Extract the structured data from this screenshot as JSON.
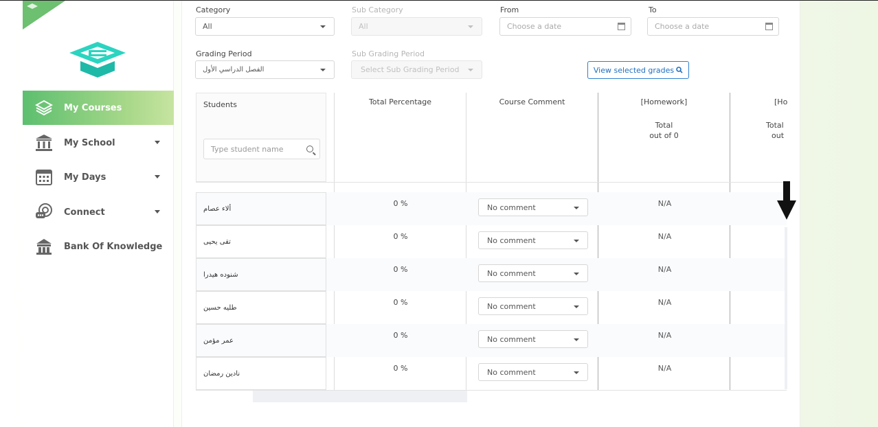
{
  "sidebar": {
    "items": [
      {
        "label": "My Courses",
        "icon": "layers-icon",
        "active": true
      },
      {
        "label": "My School",
        "icon": "school-building-icon",
        "has_caret": true
      },
      {
        "label": "My Days",
        "icon": "calendar-icon",
        "has_caret": true
      },
      {
        "label": "Connect",
        "icon": "chat-bubbles-icon",
        "has_caret": true
      },
      {
        "label": "Bank Of Knowledge",
        "icon": "bank-icon"
      }
    ]
  },
  "filters": {
    "category": {
      "label": "Category",
      "value": "All"
    },
    "sub_category": {
      "label": "Sub Category",
      "value": "All"
    },
    "from": {
      "label": "From",
      "placeholder": "Choose a date"
    },
    "to": {
      "label": "To",
      "placeholder": "Choose a date"
    },
    "grading_period": {
      "label": "Grading Period",
      "value": "الفصل الدراسي الأول"
    },
    "sub_grading_period": {
      "label": "Sub Grading Period",
      "placeholder": "Select Sub Grading Period"
    },
    "view_button": "View selected grades"
  },
  "table": {
    "students_header": "Students",
    "search_placeholder": "Type student name",
    "col_total_percentage": "Total Percentage",
    "col_course_comment": "Course Comment",
    "col_homework": "[Homework]",
    "col_homework_sub1": "Total",
    "col_homework_sub2": "out of 0",
    "col_next_partial": "[Ho",
    "col_next_sub1": "Total",
    "col_next_sub2": "out",
    "rows": [
      {
        "name": "ألاء عصام",
        "pct": "0 %",
        "comment": "No comment",
        "homework": "N/A"
      },
      {
        "name": "تقى يحيى",
        "pct": "0 %",
        "comment": "No comment",
        "homework": "N/A"
      },
      {
        "name": "شنوده هيدرا",
        "pct": "0 %",
        "comment": "No comment",
        "homework": "N/A"
      },
      {
        "name": "طليه حسين",
        "pct": "0 %",
        "comment": "No comment",
        "homework": "N/A"
      },
      {
        "name": "عمر مؤمن",
        "pct": "0 %",
        "comment": "No comment",
        "homework": "N/A"
      },
      {
        "name": "نادين رمضان",
        "pct": "0 %",
        "comment": "No comment",
        "homework": "N/A"
      }
    ]
  },
  "colors": {
    "active_nav_start": "#5cbf6f",
    "active_nav_end": "#c6e4a0",
    "button_blue": "#1f6fbf",
    "logo_teal": "#2ad4c0"
  }
}
